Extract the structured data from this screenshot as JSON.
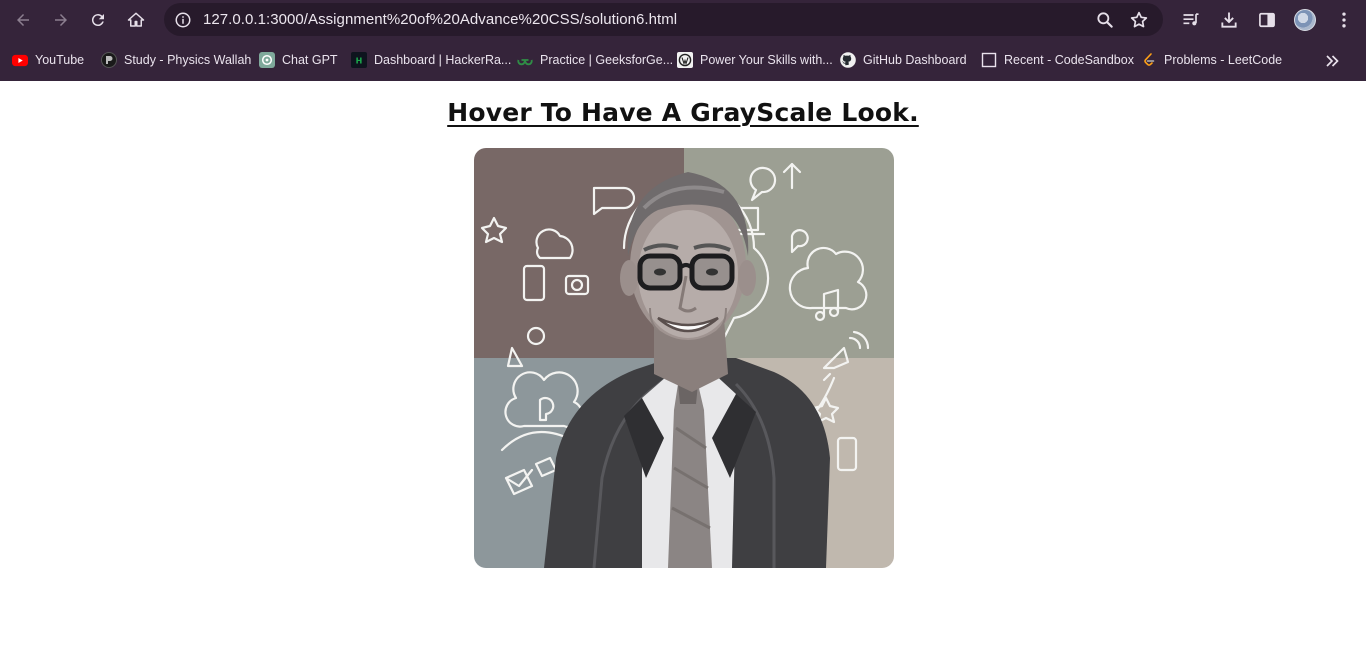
{
  "browser": {
    "url": "127.0.0.1:3000/Assignment%20of%20Advance%20CSS/solution6.html",
    "icons": {
      "back": "arrow-left-icon",
      "forward": "arrow-right-icon",
      "reload": "reload-icon",
      "home": "home-icon",
      "site_info": "info-icon",
      "zoom": "zoom-icon",
      "bookmark": "star-icon",
      "media": "media-control-icon",
      "download": "download-icon",
      "side_panel": "side-panel-icon",
      "profile": "profile-avatar",
      "menu": "kebab-menu-icon",
      "more_bookmarks": "chevron-double-right-icon"
    },
    "bookmarks": [
      {
        "label": "YouTube",
        "icon": "youtube-icon"
      },
      {
        "label": "Study - Physics Wallah",
        "icon": "physics-wallah-icon"
      },
      {
        "label": "Chat GPT",
        "icon": "chatgpt-icon"
      },
      {
        "label": "Dashboard | HackerRa...",
        "icon": "hackerrank-icon"
      },
      {
        "label": "Practice | GeeksforGe...",
        "icon": "geeksforgeeks-icon"
      },
      {
        "label": "Power Your Skills with...",
        "icon": "wordpress-icon"
      },
      {
        "label": "GitHub Dashboard",
        "icon": "github-icon"
      },
      {
        "label": "Recent - CodeSandbox",
        "icon": "codesandbox-icon"
      },
      {
        "label": "Problems - LeetCode",
        "icon": "leetcode-icon"
      }
    ]
  },
  "page": {
    "heading": "Hover To Have A GrayScale Look.",
    "image": {
      "description_icon": "portrait-image",
      "quadrant_colors": [
        "#786866",
        "#9c9f93",
        "#8d979b",
        "#c0b8ae"
      ]
    }
  },
  "colors": {
    "chrome_bg": "#35243a",
    "omnibox_bg": "#271a2b"
  }
}
